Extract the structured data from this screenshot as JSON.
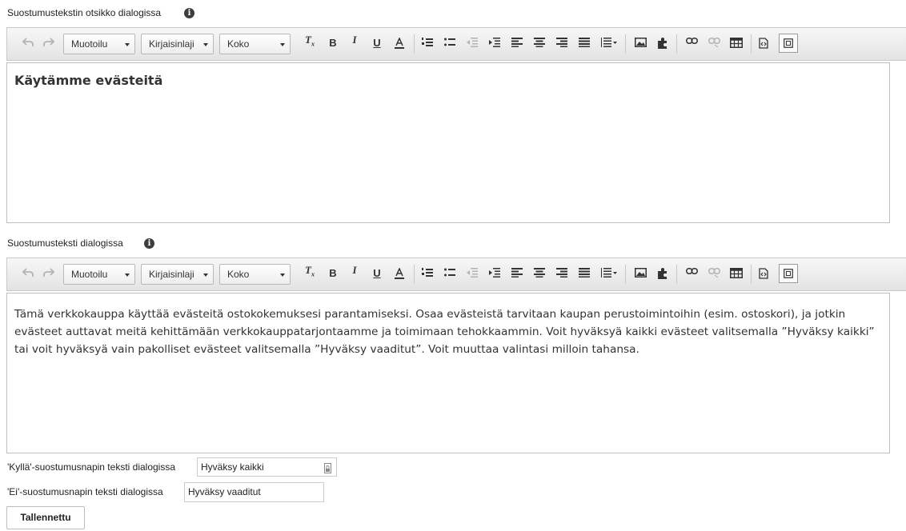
{
  "title_field": {
    "label": "Suostumustekstin otsikko dialogissa",
    "info_glyph": "i",
    "content_heading": "Käytämme evästeitä"
  },
  "body_field": {
    "label": "Suostumusteksti dialogissa",
    "info_glyph": "i",
    "content_text": "Tämä verkkokauppa käyttää evästeitä ostokokemuksesi parantamiseksi. Osaa evästeistä tarvitaan kaupan perustoimintoihin (esim. ostoskori), ja jotkin evästeet auttavat meitä kehittämään verkkokauppatarjontaamme ja toimimaan tehokkaammin. Voit hyväksyä kaikki evästeet valitsemalla ”Hyväksy kaikki” tai voit hyväksyä vain pakolliset evästeet valitsemalla ”Hyväksy vaaditut”. Voit muuttaa valintasi milloin tahansa."
  },
  "toolbar": {
    "format_label": "Muotoilu",
    "font_label": "Kirjaisinlaji",
    "size_label": "Koko",
    "icons": [
      "undo-icon",
      "redo-icon",
      "remove-format-icon",
      "bold-icon",
      "italic-icon",
      "underline-icon",
      "text-color-icon",
      "numbered-list-icon",
      "bulleted-list-icon",
      "outdent-icon",
      "indent-icon",
      "align-left-icon",
      "align-center-icon",
      "align-right-icon",
      "justify-icon",
      "line-height-icon",
      "image-icon",
      "plugin-icon",
      "link-icon",
      "unlink-icon",
      "table-icon",
      "source-icon",
      "show-blocks-icon"
    ]
  },
  "yes_button_field": {
    "label": "'Kyllä'-suostumusnapin teksti dialogissa",
    "value": "Hyväksy kaikki"
  },
  "no_button_field": {
    "label": "'Ei'-suostumusnapin teksti dialogissa",
    "value": "Hyväksy vaaditut"
  },
  "save_button": {
    "label": "Tallennettu"
  }
}
